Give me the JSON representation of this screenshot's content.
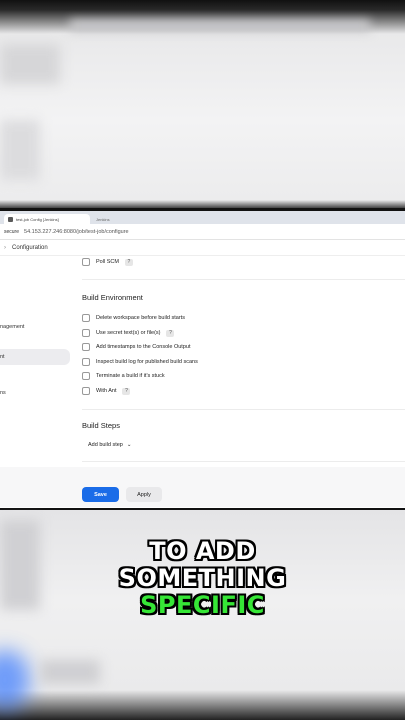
{
  "browser": {
    "tab_title": "test-job Config [Jenkins]",
    "tab_inactive": "Jenkins",
    "secure_label": "secure",
    "url": "54.153.227.246:8080/job/test-job/configure"
  },
  "breadcrumb": {
    "current": "Configuration"
  },
  "sidebar": {
    "items": [
      {
        "label": "nagement"
      },
      {
        "label": "nt"
      },
      {
        "label": "ns"
      }
    ]
  },
  "config": {
    "poll_scm": "Poll SCM",
    "build_env": {
      "title": "Build Environment",
      "options": [
        {
          "label": "Delete workspace before build starts",
          "help": false
        },
        {
          "label": "Use secret text(s) or file(s)",
          "help": true
        },
        {
          "label": "Add timestamps to the Console Output",
          "help": false
        },
        {
          "label": "Inspect build log for published build scans",
          "help": false
        },
        {
          "label": "Terminate a build if it's stuck",
          "help": false
        },
        {
          "label": "With Ant",
          "help": true
        }
      ]
    },
    "build_steps": {
      "title": "Build Steps",
      "add_label": "Add build step"
    },
    "help_glyph": "?",
    "chevron": "⌄"
  },
  "buttons": {
    "save": "Save",
    "apply": "Apply"
  },
  "caption": {
    "line1": "TO ADD",
    "line2": "SOMETHING",
    "line3": "SPECIFIC"
  },
  "colors": {
    "primary": "#1a6ce8",
    "caption_green": "#36e636"
  }
}
